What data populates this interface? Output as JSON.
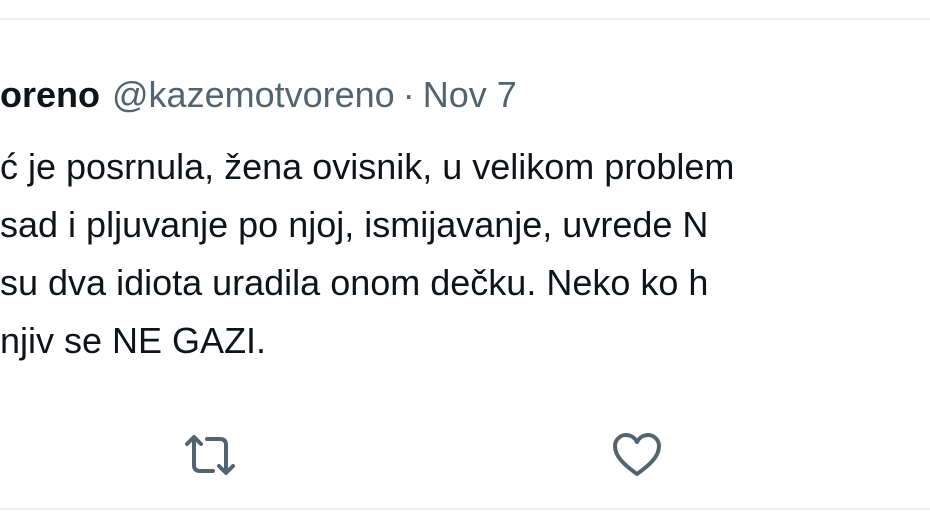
{
  "tweet": {
    "display_name": "oreno",
    "handle": "@kazemotvoreno",
    "separator": "·",
    "date": "Nov 7",
    "lines": [
      "ć je posrnula, žena ovisnik, u velikom problem",
      " sad i pljuvanje po njoj, ismijavanje, uvrede N",
      " su dva idiota uradila onom dečku. Neko ko h",
      "njiv se NE GAZI."
    ]
  },
  "actions": {
    "retweet_icon": "retweet-icon",
    "like_icon": "heart-icon",
    "icon_color": "#536471"
  },
  "colors": {
    "text": "#0f1419",
    "secondary": "#536471",
    "divider": "#eceff1"
  }
}
